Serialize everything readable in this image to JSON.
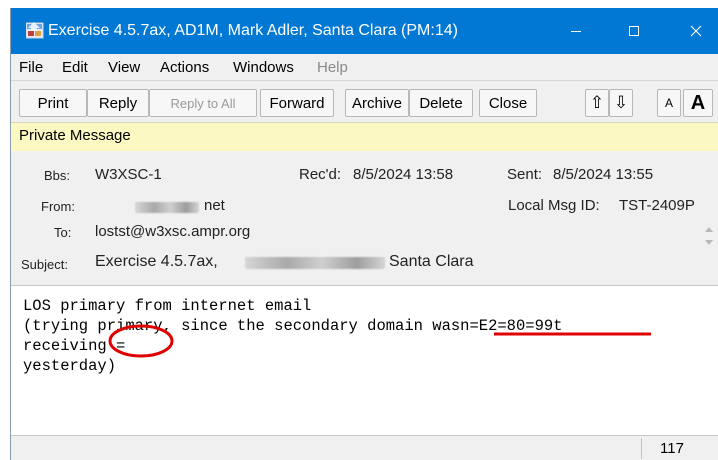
{
  "window": {
    "title": "Exercise 4.5.7ax, AD1M, Mark Adler, Santa Clara  (PM:14)",
    "minimize_glyph": "—",
    "maximize_glyph": "☐",
    "close_glyph": "✕"
  },
  "menu": {
    "file": "File",
    "edit": "Edit",
    "view": "View",
    "actions": "Actions",
    "windows": "Windows",
    "help": "Help"
  },
  "toolbar": {
    "print": "Print",
    "reply": "Reply",
    "reply_all": "Reply to All",
    "forward": "Forward",
    "archive": "Archive",
    "delete": "Delete",
    "close": "Close",
    "prev_glyph": "⇧",
    "next_glyph": "⇩",
    "font_smaller": "A",
    "font_larger": "A"
  },
  "banner": {
    "label": "Private Message"
  },
  "header": {
    "bbs_label": "Bbs:",
    "bbs_value": "W3XSC-1",
    "recd_label": "Rec'd:",
    "recd_value": "8/5/2024 13:58",
    "sent_label": "Sent:",
    "sent_value": "8/5/2024 13:55",
    "from_label": "From:",
    "from_value_visible": "net",
    "local_id_label": "Local Msg ID:",
    "local_id_value": "TST-2409P",
    "to_label": "To:",
    "to_value": "lostst@w3xsc.ampr.org",
    "subject_label": "Subject:",
    "subject_prefix": "Exercise 4.5.7ax,",
    "subject_suffix": "Santa Clara"
  },
  "body": {
    "lines": [
      "LOS primary from internet email",
      "(trying primary, since the secondary domain wasn=E2=80=99t",
      "receiving =",
      "yesterday)"
    ]
  },
  "status": {
    "count": "117"
  },
  "colors": {
    "titlebar": "#0078d4",
    "banner": "#fcf8c2",
    "annotation": "#e00000"
  }
}
